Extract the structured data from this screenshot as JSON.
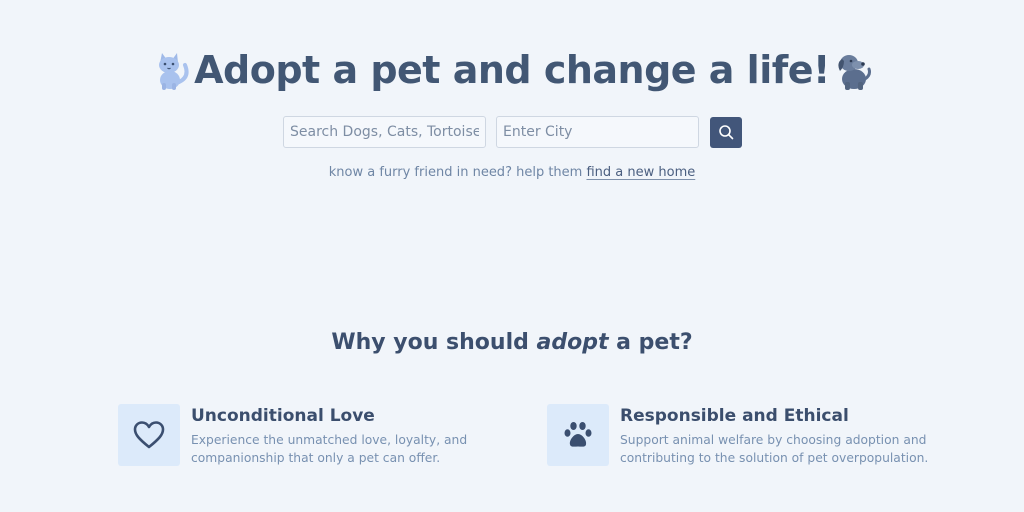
{
  "hero": {
    "title": "Adopt a pet and change a life!",
    "left_mascot_icon": "cat-icon",
    "right_mascot_icon": "dog-icon"
  },
  "search": {
    "pet_placeholder": "Search Dogs, Cats, Tortoise...",
    "city_placeholder": "Enter City",
    "button_icon": "search-icon"
  },
  "helper": {
    "text": "know a furry friend in need? help them ",
    "link": "find a new home"
  },
  "why": {
    "title_before": "Why you should ",
    "title_em": "adopt",
    "title_after": " a pet?"
  },
  "features": [
    {
      "icon": "heart-icon",
      "title": "Unconditional Love",
      "body": "Experience the unmatched love, loyalty, and companionship that only a pet can offer."
    },
    {
      "icon": "paw-icon",
      "title": "Responsible and Ethical",
      "body": "Support animal welfare by choosing adoption and contributing to the solution of pet overpopulation."
    }
  ],
  "colors": {
    "background": "#f1f5fa",
    "primary": "#42567a",
    "icon_tile": "#dceafa",
    "muted_text": "#7891b1"
  }
}
